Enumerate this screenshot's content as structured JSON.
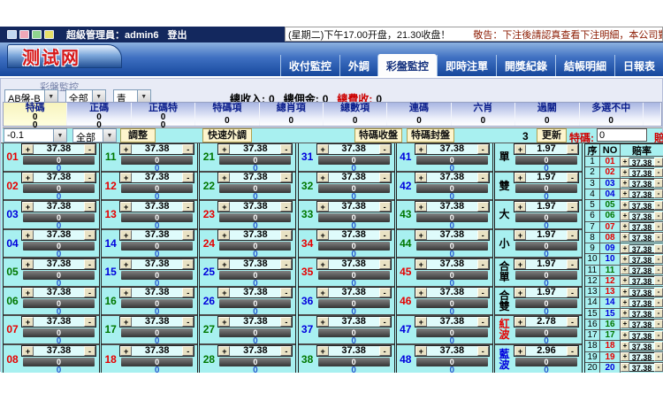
{
  "titlebar": {
    "user_prefix": "超級管理員：",
    "username": "admin6",
    "logout_label": "登出",
    "notice_time": "(星期二)下午17.00开盘，21.30收盘！",
    "notice_warning": "敬告：下注後請認真查看下注明細，本公司對開獎後的投注均"
  },
  "logo_text": "测试网",
  "nav_tabs": [
    {
      "label": "收付監控",
      "active": false
    },
    {
      "label": "外調",
      "active": false
    },
    {
      "label": "彩盤監控",
      "active": true
    },
    {
      "label": "即時注單",
      "active": false
    },
    {
      "label": "開獎紀錄",
      "active": false
    },
    {
      "label": "結帳明細",
      "active": false
    },
    {
      "label": "日報表",
      "active": false
    }
  ],
  "section_label": "彩盤監控",
  "filters": [
    {
      "name": "board-select",
      "value": "AB盤-B"
    },
    {
      "name": "scope-select",
      "value": "全部"
    },
    {
      "name": "color-select",
      "value": "青"
    }
  ],
  "stats": [
    {
      "label": "總收入:",
      "value": "0",
      "color": "#000000"
    },
    {
      "label": "總佣金:",
      "value": "0",
      "color": "#000000"
    },
    {
      "label": "總費收:",
      "value": "0",
      "color": "#cc0000"
    }
  ],
  "categories": [
    {
      "label": "特碼",
      "values": [
        "0",
        "0"
      ],
      "selected": true
    },
    {
      "label": "正碼",
      "values": [
        "0",
        "0"
      ],
      "selected": false
    },
    {
      "label": "正碼特",
      "values": [
        "0",
        "0"
      ],
      "selected": false
    },
    {
      "label": "特碼項",
      "values": [
        "0"
      ],
      "selected": false
    },
    {
      "label": "總肖項",
      "values": [
        "0"
      ],
      "selected": false
    },
    {
      "label": "總數項",
      "values": [
        "0"
      ],
      "selected": false
    },
    {
      "label": "連碼",
      "values": [
        "0"
      ],
      "selected": false
    },
    {
      "label": "六肖",
      "values": [
        "0"
      ],
      "selected": false
    },
    {
      "label": "過關",
      "values": [
        "0"
      ],
      "selected": false
    },
    {
      "label": "多選不中",
      "values": [
        "0"
      ],
      "selected": false
    }
  ],
  "controls": {
    "adjust_step": "-0.1",
    "adjust_scope": "全部",
    "adjust_button": "調整",
    "quick_adjust_button": "快速外調",
    "close_button": "特碼收盤",
    "seal_button": "特碼封盤",
    "refresh_count": "3",
    "update_button": "更新",
    "special_label": "特碼:",
    "special_input_value": "0",
    "odds_label": "賠率"
  },
  "icons": {
    "dropdown_arrow": "▼",
    "plus": "+",
    "minus": "-"
  },
  "defaults": {
    "odds": "37.38",
    "volume": "0",
    "amount": "0"
  },
  "number_colors": {
    "r": "#e60000",
    "b": "#0000dd",
    "g": "#007700",
    "k": "#000000"
  },
  "grid_columns": [
    [
      {
        "no": "01",
        "c": "r"
      },
      {
        "no": "02",
        "c": "r"
      },
      {
        "no": "03",
        "c": "b"
      },
      {
        "no": "04",
        "c": "b"
      },
      {
        "no": "05",
        "c": "g"
      },
      {
        "no": "06",
        "c": "g"
      },
      {
        "no": "07",
        "c": "r"
      },
      {
        "no": "08",
        "c": "r"
      }
    ],
    [
      {
        "no": "11",
        "c": "g"
      },
      {
        "no": "12",
        "c": "r"
      },
      {
        "no": "13",
        "c": "r"
      },
      {
        "no": "14",
        "c": "b"
      },
      {
        "no": "15",
        "c": "b"
      },
      {
        "no": "16",
        "c": "g"
      },
      {
        "no": "17",
        "c": "g"
      },
      {
        "no": "18",
        "c": "r"
      }
    ],
    [
      {
        "no": "21",
        "c": "g"
      },
      {
        "no": "22",
        "c": "g"
      },
      {
        "no": "23",
        "c": "r"
      },
      {
        "no": "24",
        "c": "r"
      },
      {
        "no": "25",
        "c": "b"
      },
      {
        "no": "26",
        "c": "b"
      },
      {
        "no": "27",
        "c": "g"
      },
      {
        "no": "28",
        "c": "g"
      }
    ],
    [
      {
        "no": "31",
        "c": "b"
      },
      {
        "no": "32",
        "c": "g"
      },
      {
        "no": "33",
        "c": "g"
      },
      {
        "no": "34",
        "c": "r"
      },
      {
        "no": "35",
        "c": "r"
      },
      {
        "no": "36",
        "c": "b"
      },
      {
        "no": "37",
        "c": "b"
      },
      {
        "no": "38",
        "c": "g"
      }
    ],
    [
      {
        "no": "41",
        "c": "b"
      },
      {
        "no": "42",
        "c": "b"
      },
      {
        "no": "43",
        "c": "g"
      },
      {
        "no": "44",
        "c": "g"
      },
      {
        "no": "45",
        "c": "r"
      },
      {
        "no": "46",
        "c": "r"
      },
      {
        "no": "47",
        "c": "b"
      },
      {
        "no": "48",
        "c": "b"
      }
    ]
  ],
  "special_bets": [
    {
      "label": "單",
      "odds": "1.97",
      "c": "k"
    },
    {
      "label": "雙",
      "odds": "1.97",
      "c": "k"
    },
    {
      "label": "大",
      "odds": "1.97",
      "c": "k"
    },
    {
      "label": "小",
      "odds": "1.97",
      "c": "k"
    },
    {
      "label": "合單",
      "odds": "1.97",
      "c": "k"
    },
    {
      "label": "合雙",
      "odds": "1.97",
      "c": "k"
    },
    {
      "label": "紅波",
      "odds": "2.78",
      "c": "r"
    },
    {
      "label": "藍波",
      "odds": "2.96",
      "c": "b"
    }
  ],
  "odds_table": {
    "headers": [
      "序",
      "NO",
      "賠率"
    ],
    "rows": [
      {
        "idx": "1",
        "no": "01",
        "c": "r"
      },
      {
        "idx": "2",
        "no": "02",
        "c": "r"
      },
      {
        "idx": "3",
        "no": "03",
        "c": "b"
      },
      {
        "idx": "4",
        "no": "04",
        "c": "b"
      },
      {
        "idx": "5",
        "no": "05",
        "c": "g"
      },
      {
        "idx": "6",
        "no": "06",
        "c": "g"
      },
      {
        "idx": "7",
        "no": "07",
        "c": "r"
      },
      {
        "idx": "8",
        "no": "08",
        "c": "r"
      },
      {
        "idx": "9",
        "no": "09",
        "c": "b"
      },
      {
        "idx": "10",
        "no": "10",
        "c": "b"
      },
      {
        "idx": "11",
        "no": "11",
        "c": "g"
      },
      {
        "idx": "12",
        "no": "12",
        "c": "r"
      },
      {
        "idx": "13",
        "no": "13",
        "c": "r"
      },
      {
        "idx": "14",
        "no": "14",
        "c": "b"
      },
      {
        "idx": "15",
        "no": "15",
        "c": "b"
      },
      {
        "idx": "16",
        "no": "16",
        "c": "g"
      },
      {
        "idx": "17",
        "no": "17",
        "c": "g"
      },
      {
        "idx": "18",
        "no": "18",
        "c": "r"
      },
      {
        "idx": "19",
        "no": "19",
        "c": "r"
      },
      {
        "idx": "20",
        "no": "20",
        "c": "b"
      }
    ]
  }
}
